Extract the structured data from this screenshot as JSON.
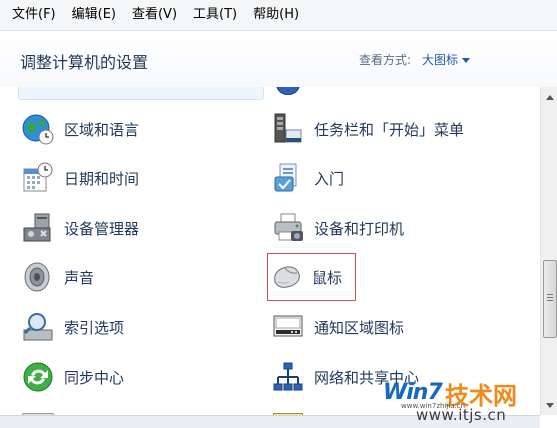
{
  "menu": [
    "文件(F)",
    "编辑(E)",
    "查看(V)",
    "工具(T)",
    "帮助(H)"
  ],
  "header": {
    "title": "调整计算机的设置",
    "view_label": "查看方式:",
    "view_value": "大图标"
  },
  "items": [
    {
      "label": "区域和语言",
      "icon": "globe-clock-icon"
    },
    {
      "label": "任务栏和「开始」菜单",
      "icon": "taskbar-icon"
    },
    {
      "label": "日期和时间",
      "icon": "calendar-clock-icon"
    },
    {
      "label": "入门",
      "icon": "getting-started-icon"
    },
    {
      "label": "设备管理器",
      "icon": "device-manager-icon"
    },
    {
      "label": "设备和打印机",
      "icon": "printer-icon"
    },
    {
      "label": "声音",
      "icon": "speaker-icon"
    },
    {
      "label": "鼠标",
      "icon": "mouse-icon"
    },
    {
      "label": "索引选项",
      "icon": "index-search-icon"
    },
    {
      "label": "通知区域图标",
      "icon": "notification-area-icon"
    },
    {
      "label": "同步中心",
      "icon": "sync-icon"
    },
    {
      "label": "网络和共享中心",
      "icon": "network-icon"
    }
  ],
  "watermark": {
    "logo": "Win7",
    "brand": "技术网",
    "url": "www.itjs.cn",
    "small": "www.win7zhijia.cn"
  },
  "colors": {
    "accent": "#1e5aa8",
    "text": "#1e395b",
    "selection_border": "#d6504a"
  }
}
